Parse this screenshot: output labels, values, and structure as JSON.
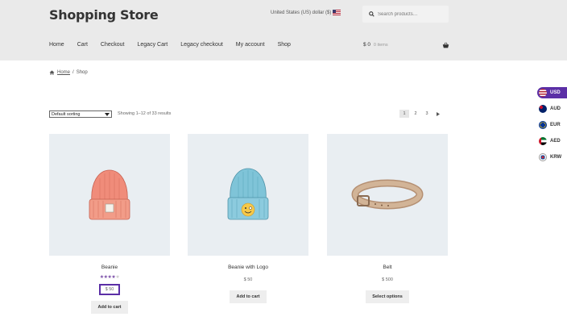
{
  "header": {
    "site_title": "Shopping Store",
    "currency_label": "United States (US) dollar ($)",
    "search_placeholder": "Search products…"
  },
  "nav": [
    "Home",
    "Cart",
    "Checkout",
    "Legacy Cart",
    "Legacy checkout",
    "My account",
    "Shop"
  ],
  "cart": {
    "total": "$ 0",
    "items": "0 items"
  },
  "breadcrumb": {
    "home": "Home",
    "current": "Shop"
  },
  "toolbar": {
    "sorting": "Default sorting",
    "showing": "Showing 1–12 of 33 results",
    "pages": [
      "1",
      "2",
      "3"
    ],
    "current_page": "1"
  },
  "currencies": [
    {
      "code": "USD",
      "active": true
    },
    {
      "code": "AUD",
      "active": false
    },
    {
      "code": "EUR",
      "active": false
    },
    {
      "code": "AED",
      "active": false
    },
    {
      "code": "KRW",
      "active": false
    }
  ],
  "products": [
    {
      "name": "Beanie",
      "rating": 4,
      "price": "$ 50",
      "button": "Add to cart",
      "image": "orange-beanie"
    },
    {
      "name": "Beanie with Logo",
      "price": "$ 50",
      "button": "Add to cart",
      "image": "blue-beanie-logo"
    },
    {
      "name": "Belt",
      "price": "$ 500",
      "button": "Select options",
      "image": "leather-belt"
    }
  ],
  "colors": {
    "accent": "#5b2fa6",
    "header_bg": "#eaeaea",
    "product_bg": "#e9eef2"
  }
}
